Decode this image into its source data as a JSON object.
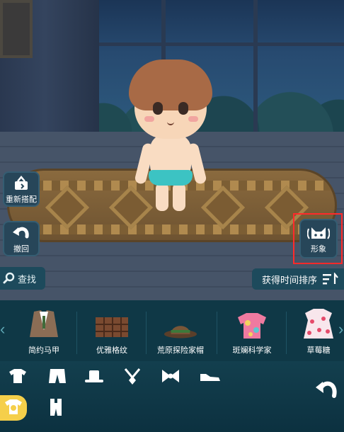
{
  "scene": {
    "actions": {
      "reset_label": "重新搭配",
      "undo_label": "撤回"
    },
    "image_button_label": "形象"
  },
  "toolbar": {
    "search_label": "查找",
    "sort_label": "获得时间排序"
  },
  "items": [
    {
      "label": "简约马甲",
      "icon": "vest-icon"
    },
    {
      "label": "优雅格纹",
      "icon": "plaid-skirt-icon"
    },
    {
      "label": "荒原探险家帽",
      "icon": "explorer-hat-icon"
    },
    {
      "label": "斑斓科学家",
      "icon": "colorful-shirt-icon"
    },
    {
      "label": "草莓糖",
      "icon": "strawberry-dress-icon"
    }
  ],
  "categories": [
    {
      "name": "top",
      "icon": "shirt-icon"
    },
    {
      "name": "bottom",
      "icon": "pants-icon"
    },
    {
      "name": "hat",
      "icon": "hat-icon"
    },
    {
      "name": "necklace",
      "icon": "necklace-icon"
    },
    {
      "name": "hair-accessory",
      "icon": "bow-icon"
    },
    {
      "name": "shoes",
      "icon": "shoe-icon"
    },
    {
      "name": "suit",
      "icon": "suit-icon",
      "active": true
    },
    {
      "name": "outfit",
      "icon": "overalls-icon"
    }
  ],
  "colors": {
    "panel_bg": "#0f3846",
    "active_category": "#f5cf4a",
    "highlight_box": "#ff2a2a",
    "button_bg": "#274659"
  }
}
